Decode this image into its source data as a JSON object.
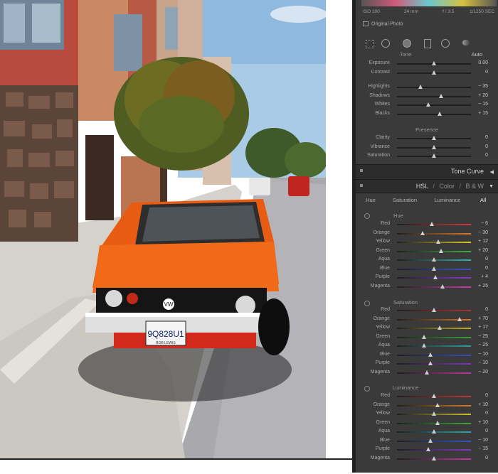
{
  "meta_strip": {
    "iso": "ISO 100",
    "focal": "24 mm",
    "aperture": "f / 3.5",
    "shutter": "1/1250 SEC",
    "original": "Original Photo"
  },
  "tone": {
    "title": "Tone",
    "auto": "Auto",
    "sliders": [
      {
        "label": "Exposure",
        "value": "0.00",
        "pos": 0.5
      },
      {
        "label": "Contrast",
        "value": "0",
        "pos": 0.5
      },
      {
        "label": "Highlights",
        "value": "− 35",
        "pos": 0.32
      },
      {
        "label": "Shadows",
        "value": "+ 20",
        "pos": 0.6
      },
      {
        "label": "Whites",
        "value": "− 15",
        "pos": 0.42
      },
      {
        "label": "Blacks",
        "value": "+ 15",
        "pos": 0.58
      }
    ]
  },
  "presence": {
    "title": "Presence",
    "sliders": [
      {
        "label": "Clarity",
        "value": "0",
        "pos": 0.5
      },
      {
        "label": "Vibrance",
        "value": "0",
        "pos": 0.5
      },
      {
        "label": "Saturation",
        "value": "0",
        "pos": 0.5
      }
    ]
  },
  "tone_curve": {
    "title": "Tone Curve"
  },
  "hsl": {
    "title_parts": [
      "HSL",
      "/",
      "Color",
      "/",
      "B & W"
    ],
    "tabs": [
      "Hue",
      "Saturation",
      "Luminance",
      "All"
    ],
    "hue": {
      "title": "Hue",
      "sliders": [
        {
          "label": "Red",
          "value": "− 6",
          "pos": 0.47,
          "color": "#d23a3a"
        },
        {
          "label": "Orange",
          "value": "− 30",
          "pos": 0.35,
          "color": "#e07a22"
        },
        {
          "label": "Yellow",
          "value": "+ 12",
          "pos": 0.56,
          "color": "#d6c629"
        },
        {
          "label": "Green",
          "value": "+ 20",
          "pos": 0.6,
          "color": "#3fae3f"
        },
        {
          "label": "Aqua",
          "value": "0",
          "pos": 0.5,
          "color": "#2fb3b3"
        },
        {
          "label": "Blue",
          "value": "0",
          "pos": 0.5,
          "color": "#3a56d0"
        },
        {
          "label": "Purple",
          "value": "+ 4",
          "pos": 0.52,
          "color": "#8a3ad0"
        },
        {
          "label": "Magenta",
          "value": "+ 25",
          "pos": 0.62,
          "color": "#cf3aa8"
        }
      ]
    },
    "saturation": {
      "title": "Saturation",
      "sliders": [
        {
          "label": "Red",
          "value": "0",
          "pos": 0.5,
          "color": "#b03232"
        },
        {
          "label": "Orange",
          "value": "+ 70",
          "pos": 0.85,
          "color": "#d8751f"
        },
        {
          "label": "Yellow",
          "value": "+ 17",
          "pos": 0.58,
          "color": "#c2b424"
        },
        {
          "label": "Green",
          "value": "− 25",
          "pos": 0.37,
          "color": "#3c9f3c"
        },
        {
          "label": "Aqua",
          "value": "− 25",
          "pos": 0.37,
          "color": "#2aa0a0"
        },
        {
          "label": "Blue",
          "value": "− 10",
          "pos": 0.45,
          "color": "#3651c0"
        },
        {
          "label": "Purple",
          "value": "− 10",
          "pos": 0.45,
          "color": "#7d36c0"
        },
        {
          "label": "Magenta",
          "value": "− 20",
          "pos": 0.4,
          "color": "#bf349a"
        }
      ]
    },
    "luminance": {
      "title": "Luminance",
      "sliders": [
        {
          "label": "Red",
          "value": "0",
          "pos": 0.5,
          "color": "#c23838"
        },
        {
          "label": "Orange",
          "value": "+ 10",
          "pos": 0.55,
          "color": "#dd7a20"
        },
        {
          "label": "Yellow",
          "value": "0",
          "pos": 0.5,
          "color": "#d0c12a"
        },
        {
          "label": "Green",
          "value": "+ 10",
          "pos": 0.55,
          "color": "#3ea83e"
        },
        {
          "label": "Aqua",
          "value": "0",
          "pos": 0.5,
          "color": "#2caaaa"
        },
        {
          "label": "Blue",
          "value": "− 10",
          "pos": 0.45,
          "color": "#3753c8"
        },
        {
          "label": "Purple",
          "value": "− 15",
          "pos": 0.42,
          "color": "#8538c8"
        },
        {
          "label": "Magenta",
          "value": "0",
          "pos": 0.5,
          "color": "#c836a1"
        }
      ]
    }
  },
  "plate": {
    "number": "9Q828U1",
    "frame": "BOB LEWIS"
  },
  "emblem": "VW"
}
